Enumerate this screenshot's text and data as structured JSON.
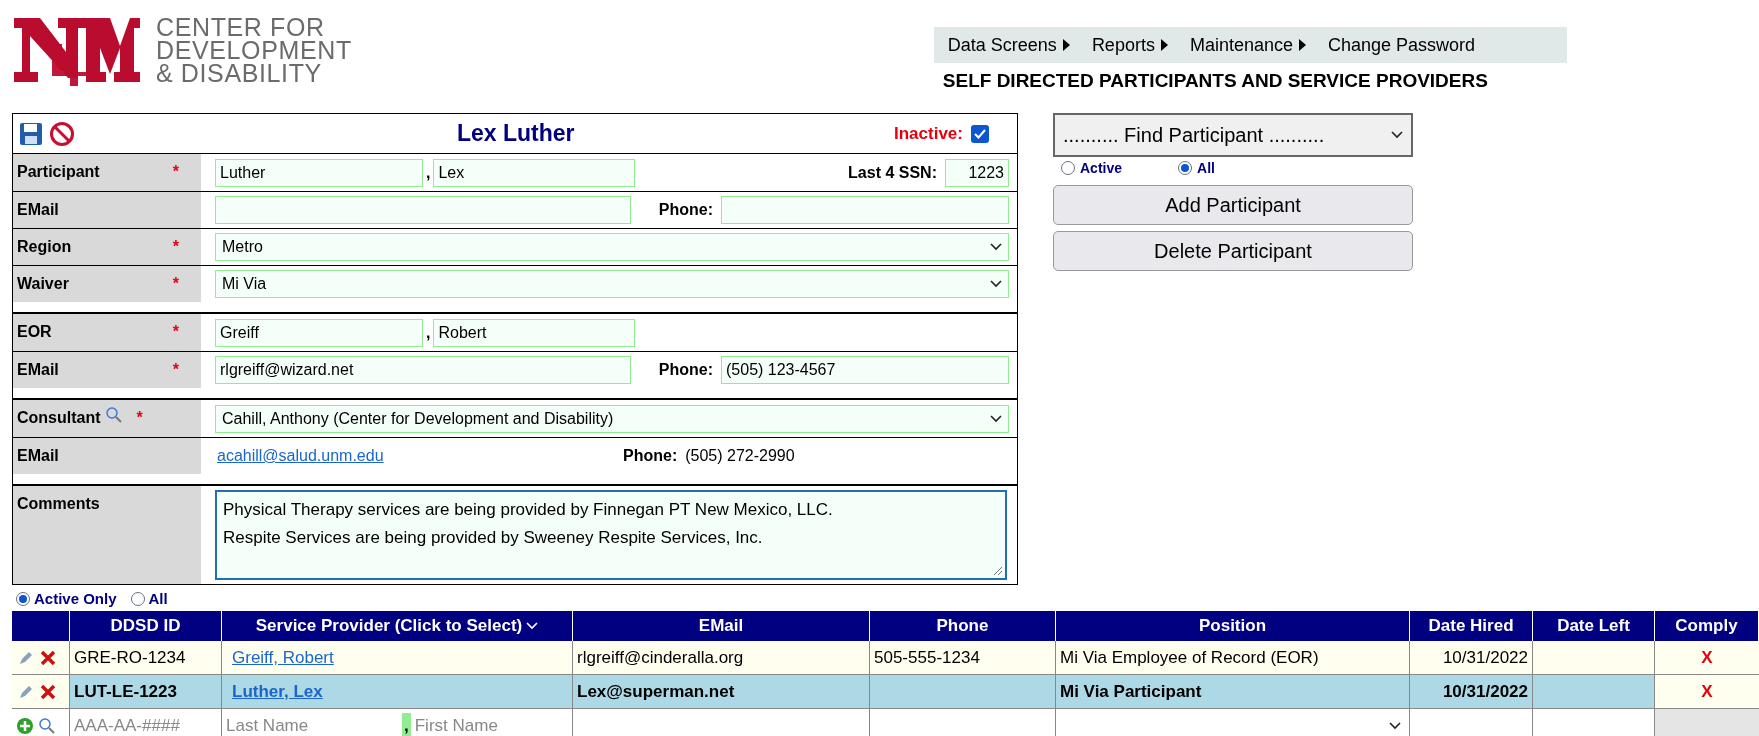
{
  "header": {
    "org_name": [
      "CENTER FOR",
      "DEVELOPMENT",
      "& DISABILITY"
    ],
    "menu": [
      {
        "label": "Data Screens",
        "submenu": true
      },
      {
        "label": "Reports",
        "submenu": true
      },
      {
        "label": "Maintenance",
        "submenu": true
      },
      {
        "label": "Change Password",
        "submenu": false
      }
    ],
    "page_title": "SELF DIRECTED PARTICIPANTS AND SERVICE PROVIDERS"
  },
  "form": {
    "title": "Lex Luther",
    "inactive_label": "Inactive:",
    "inactive": true,
    "groups": [
      [
        {
          "kind": "name",
          "label": "Participant",
          "required_mark": "*",
          "last": "Luther",
          "separator": ",",
          "first": "Lex",
          "extra_label": "Last 4 SSN:",
          "extra_value": "1223"
        },
        {
          "kind": "contact",
          "label": "EMail",
          "phone_label": "Phone:"
        },
        {
          "kind": "select",
          "label": "Region",
          "required_mark": "*",
          "value": "Metro"
        },
        {
          "kind": "select",
          "label": "Waiver",
          "required_mark": "*",
          "value": "Mi Via"
        }
      ],
      [
        {
          "kind": "name",
          "label": "EOR",
          "required_mark": "*",
          "last": "Greiff",
          "separator": ",",
          "first": "Robert"
        },
        {
          "kind": "contact",
          "label": "EMail",
          "required_mark": "*",
          "email": "rlgreiff@wizard.net",
          "phone_label": "Phone:",
          "phone": "(505) 123-4567"
        }
      ],
      [
        {
          "kind": "select",
          "label": "Consultant",
          "required_mark": "*",
          "search": true,
          "value": "Cahill, Anthony (Center for Development and Disability)"
        },
        {
          "kind": "link_contact",
          "label": "EMail",
          "email": "acahill@salud.unm.edu",
          "phone_label": "Phone:",
          "phone": "(505) 272-2990"
        }
      ],
      [
        {
          "kind": "textarea",
          "label": "Comments",
          "lines": [
            "Physical Therapy services are being provided by Finnegan PT New Mexico, LLC.",
            "Respite Services are being provided by Sweeney Respite Services, Inc."
          ]
        }
      ]
    ]
  },
  "finder": {
    "select": ".......... Find Participant ..........",
    "filters": [
      {
        "label": "Active",
        "selected": false
      },
      {
        "label": "All",
        "selected": true
      }
    ],
    "buttons": [
      "Add Participant",
      "Delete Participant"
    ]
  },
  "provider_filter": [
    {
      "label": "Active Only",
      "selected": true
    },
    {
      "label": "All",
      "selected": false
    }
  ],
  "table": {
    "columns": [
      "DDSD ID",
      "Service Provider (Click to Select)",
      "EMail",
      "Phone",
      "Position",
      "Date Hired",
      "Date Left",
      "Comply"
    ],
    "rows": [
      {
        "selected": false,
        "ddsd_id": "GRE-RO-1234",
        "provider": "Greiff, Robert",
        "email": "rlgreiff@cinderalla.org",
        "phone": "505-555-1234",
        "position": "Mi Via Employee of Record (EOR)",
        "date_hired": "10/31/2022",
        "comply": "X"
      },
      {
        "selected": true,
        "ddsd_id": "LUT-LE-1223",
        "provider": "Luther, Lex",
        "email": "Lex@superman.net",
        "position": "Mi Via Participant",
        "date_hired": "10/31/2022",
        "comply": "X"
      }
    ],
    "new_row": {
      "id_placeholder": "AAA-AA-####",
      "last_placeholder": "Last Name",
      "separator": ",",
      "first_placeholder": "First Name"
    }
  }
}
